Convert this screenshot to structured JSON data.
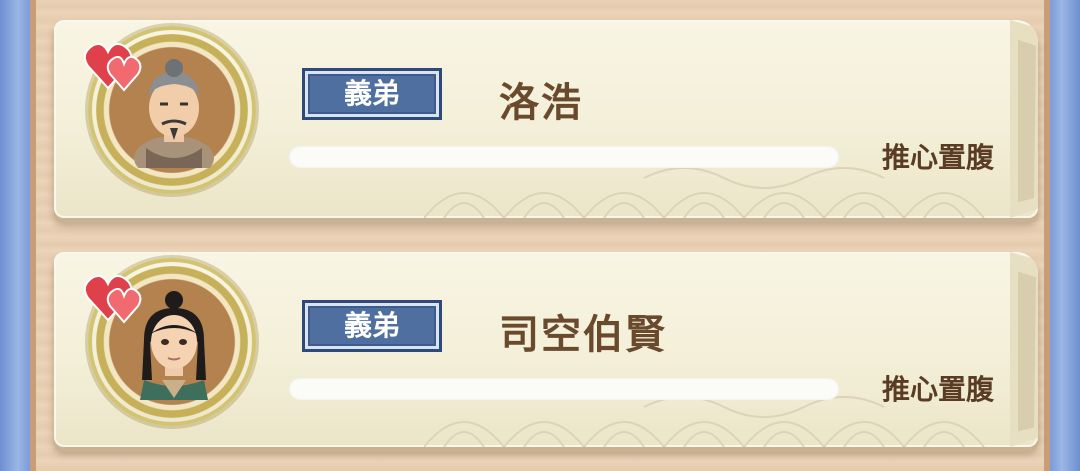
{
  "cards": [
    {
      "relation": "義弟",
      "name": "洛浩",
      "bond_label": "推心置腹",
      "avatar": "elder-man-portrait",
      "affection": "heart-icon",
      "progress": 0
    },
    {
      "relation": "義弟",
      "name": "司空伯賢",
      "bond_label": "推心置腹",
      "avatar": "young-man-portrait",
      "affection": "heart-icon",
      "progress": 0
    }
  ],
  "colors": {
    "badge": "#4e6fa0",
    "name": "#6a4a2c",
    "scroll": "#f3efd8",
    "frame": "#d2c472",
    "background": "#7f9fd6"
  }
}
